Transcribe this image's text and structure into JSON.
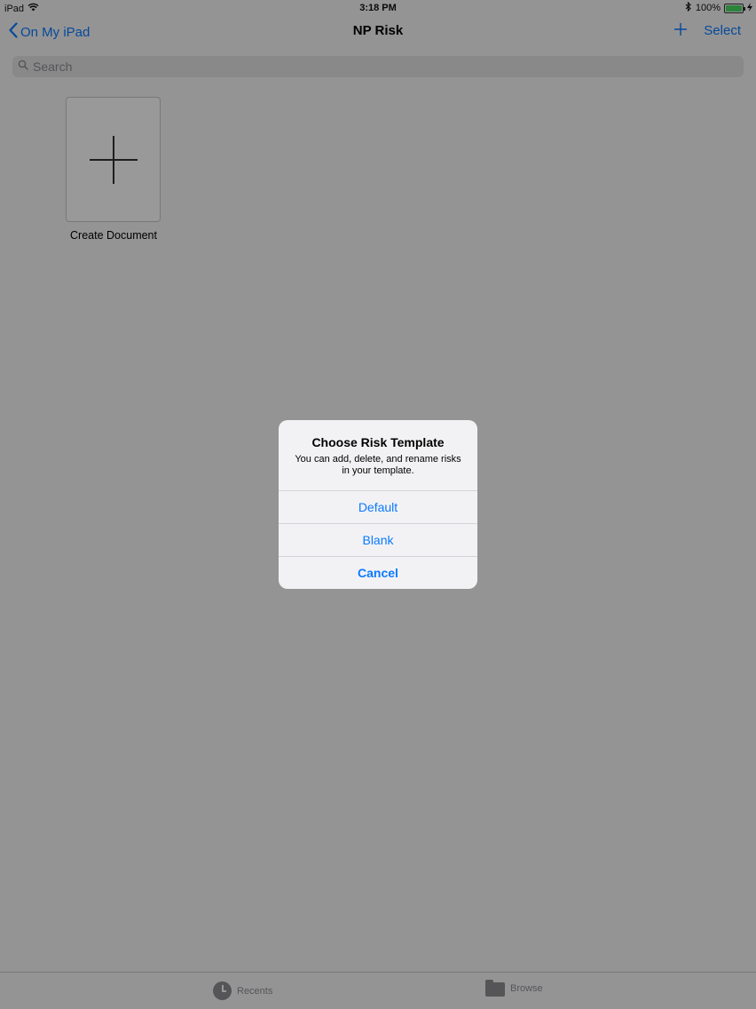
{
  "status_bar": {
    "device": "iPad",
    "time": "3:18 PM",
    "battery": "100%",
    "icons": [
      "wifi-icon",
      "bluetooth-icon",
      "battery-icon",
      "charging-icon"
    ]
  },
  "nav": {
    "back_label": "On My iPad",
    "title": "NP Risk",
    "add_icon": "plus-icon",
    "select_label": "Select"
  },
  "search": {
    "placeholder": "Search"
  },
  "create_document": {
    "label": "Create Document"
  },
  "tab_bar": {
    "tabs": [
      {
        "label": "Recents",
        "icon": "clock-icon"
      },
      {
        "label": "Browse",
        "icon": "folder-icon"
      }
    ]
  },
  "alert": {
    "title": "Choose Risk Template",
    "message": "You can add, delete, and rename risks in your template.",
    "buttons": [
      {
        "label": "Default"
      },
      {
        "label": "Blank"
      },
      {
        "label": "Cancel"
      }
    ]
  },
  "colors": {
    "accent": "#0a7aff",
    "background": "#f7f7f8",
    "dim_overlay": "rgba(0,0,0,0.4)"
  }
}
